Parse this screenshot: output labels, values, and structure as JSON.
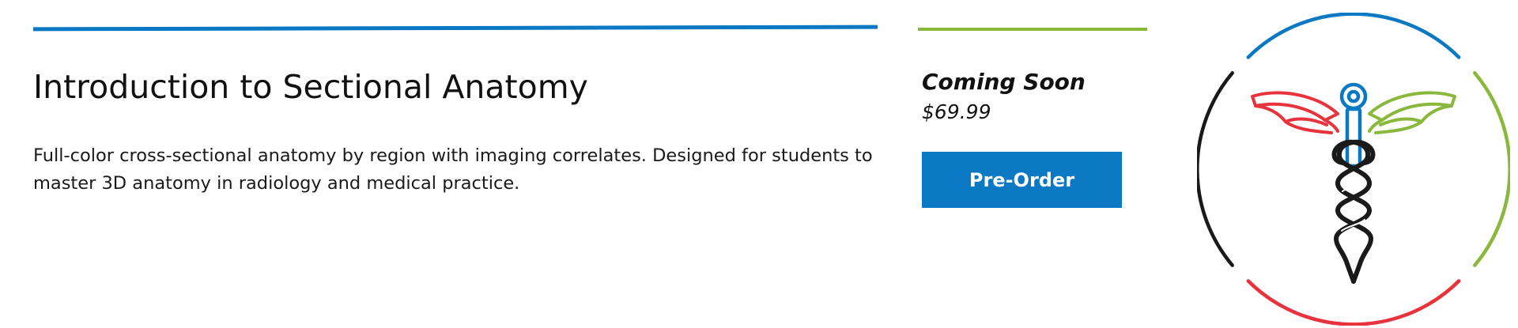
{
  "product": {
    "title": "Introduction to Sectional Anatomy",
    "description": "Full-color cross-sectional anatomy by region with imaging correlates. Designed for students to master 3D anatomy in radiology and medical practice.",
    "status": "Coming Soon",
    "price": "$69.99",
    "button_label": "Pre-Order"
  },
  "emblem": {
    "icon": "caduceus-icon",
    "ring_colors": [
      "#0a78c2",
      "#8ab83d",
      "#e8323c",
      "#1a1a1a"
    ],
    "wing_left_color": "#e8323c",
    "wing_right_color": "#8ab83d",
    "staff_color": "#0a78c2"
  },
  "colors": {
    "accent_blue": "#0a78c2",
    "accent_green": "#8ab83d",
    "accent_red": "#e8323c"
  }
}
